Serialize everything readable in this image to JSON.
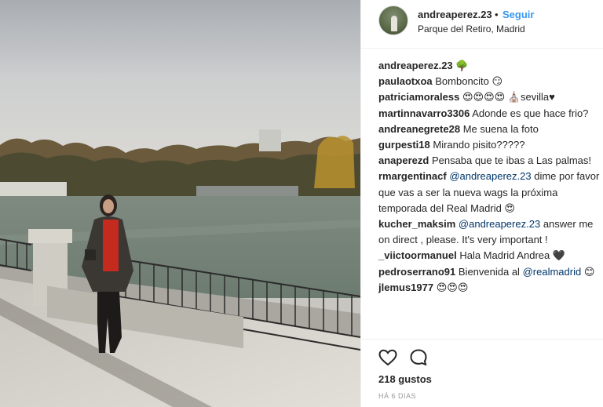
{
  "post": {
    "username": "andreaperez.23",
    "separator": "•",
    "follow_label": "Seguir",
    "location": "Parque del Retiro, Madrid"
  },
  "caption": {
    "user": "andreaperez.23",
    "text": "🌳"
  },
  "comments": [
    {
      "user": "paulaotxoa",
      "text": "Bomboncito 😏"
    },
    {
      "user": "patriciamoraless",
      "text": "😍😍😍😍 ⛪sevilla♥"
    },
    {
      "user": "martinnavarro3306",
      "text": "Adonde es que hace frio?"
    },
    {
      "user": "andreanegrete28",
      "text": "Me suena la foto"
    },
    {
      "user": "gurpesti18",
      "text": "Mirando pisito?????"
    },
    {
      "user": "anaperezd",
      "text": "Pensaba que te ibas a Las palmas!"
    },
    {
      "user": "rmargentinacf",
      "mention": "@andreaperez.23",
      "text": "dime por favor que vas a ser la nueva wags la próxima temporada del Real Madrid 😍"
    },
    {
      "user": "kucher_maksim",
      "mention": "@andreaperez.23",
      "text": "answer me on direct , please. It's very important !"
    },
    {
      "user": "_viictoormanuel",
      "text": "Hala Madrid Andrea 🖤"
    },
    {
      "user": "pedroserrano91",
      "text": "Bienvenida al",
      "mention_after": "@realmadrid",
      "text_after": "😊"
    },
    {
      "user": "jlemus1977",
      "text": "😍😍😍"
    }
  ],
  "engagement": {
    "likes_text": "218 gustos",
    "time_ago": "HÁ 6 DIAS"
  },
  "icons": {
    "like": "heart-outline-icon",
    "comment": "speech-bubble-icon"
  },
  "colors": {
    "link_blue": "#3897f0",
    "mention_blue": "#003569",
    "text": "#262626",
    "muted": "#999999"
  }
}
